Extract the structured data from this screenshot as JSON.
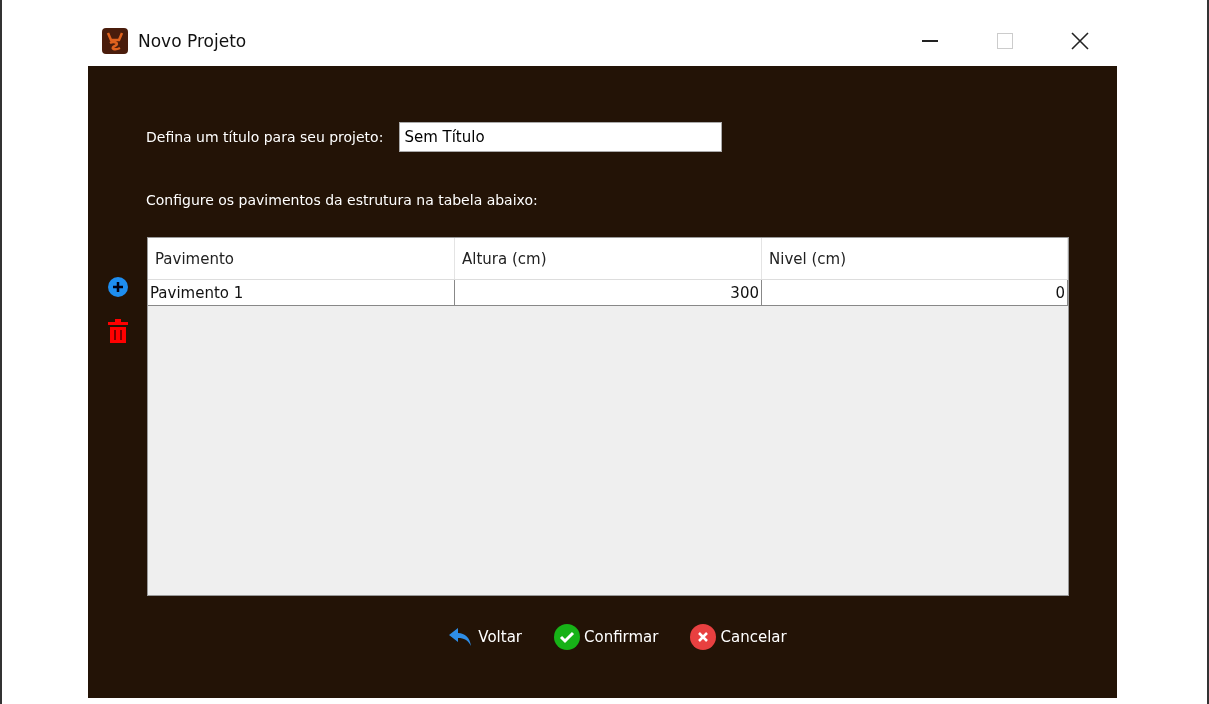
{
  "window": {
    "title": "Novo Projeto"
  },
  "title_field": {
    "label": "Defina um título para seu projeto:",
    "value": "Sem Título"
  },
  "table_label": "Configure os pavimentos da estrutura na tabela abaixo:",
  "table": {
    "columns": [
      "Pavimento",
      "Altura (cm)",
      "Nivel (cm)"
    ],
    "rows": [
      [
        "Pavimento 1",
        "300",
        "0"
      ]
    ]
  },
  "buttons": [
    {
      "kind": "back",
      "label": "Voltar"
    },
    {
      "kind": "confirm",
      "label": "Confirmar"
    },
    {
      "kind": "cancel",
      "label": "Cancelar"
    }
  ]
}
